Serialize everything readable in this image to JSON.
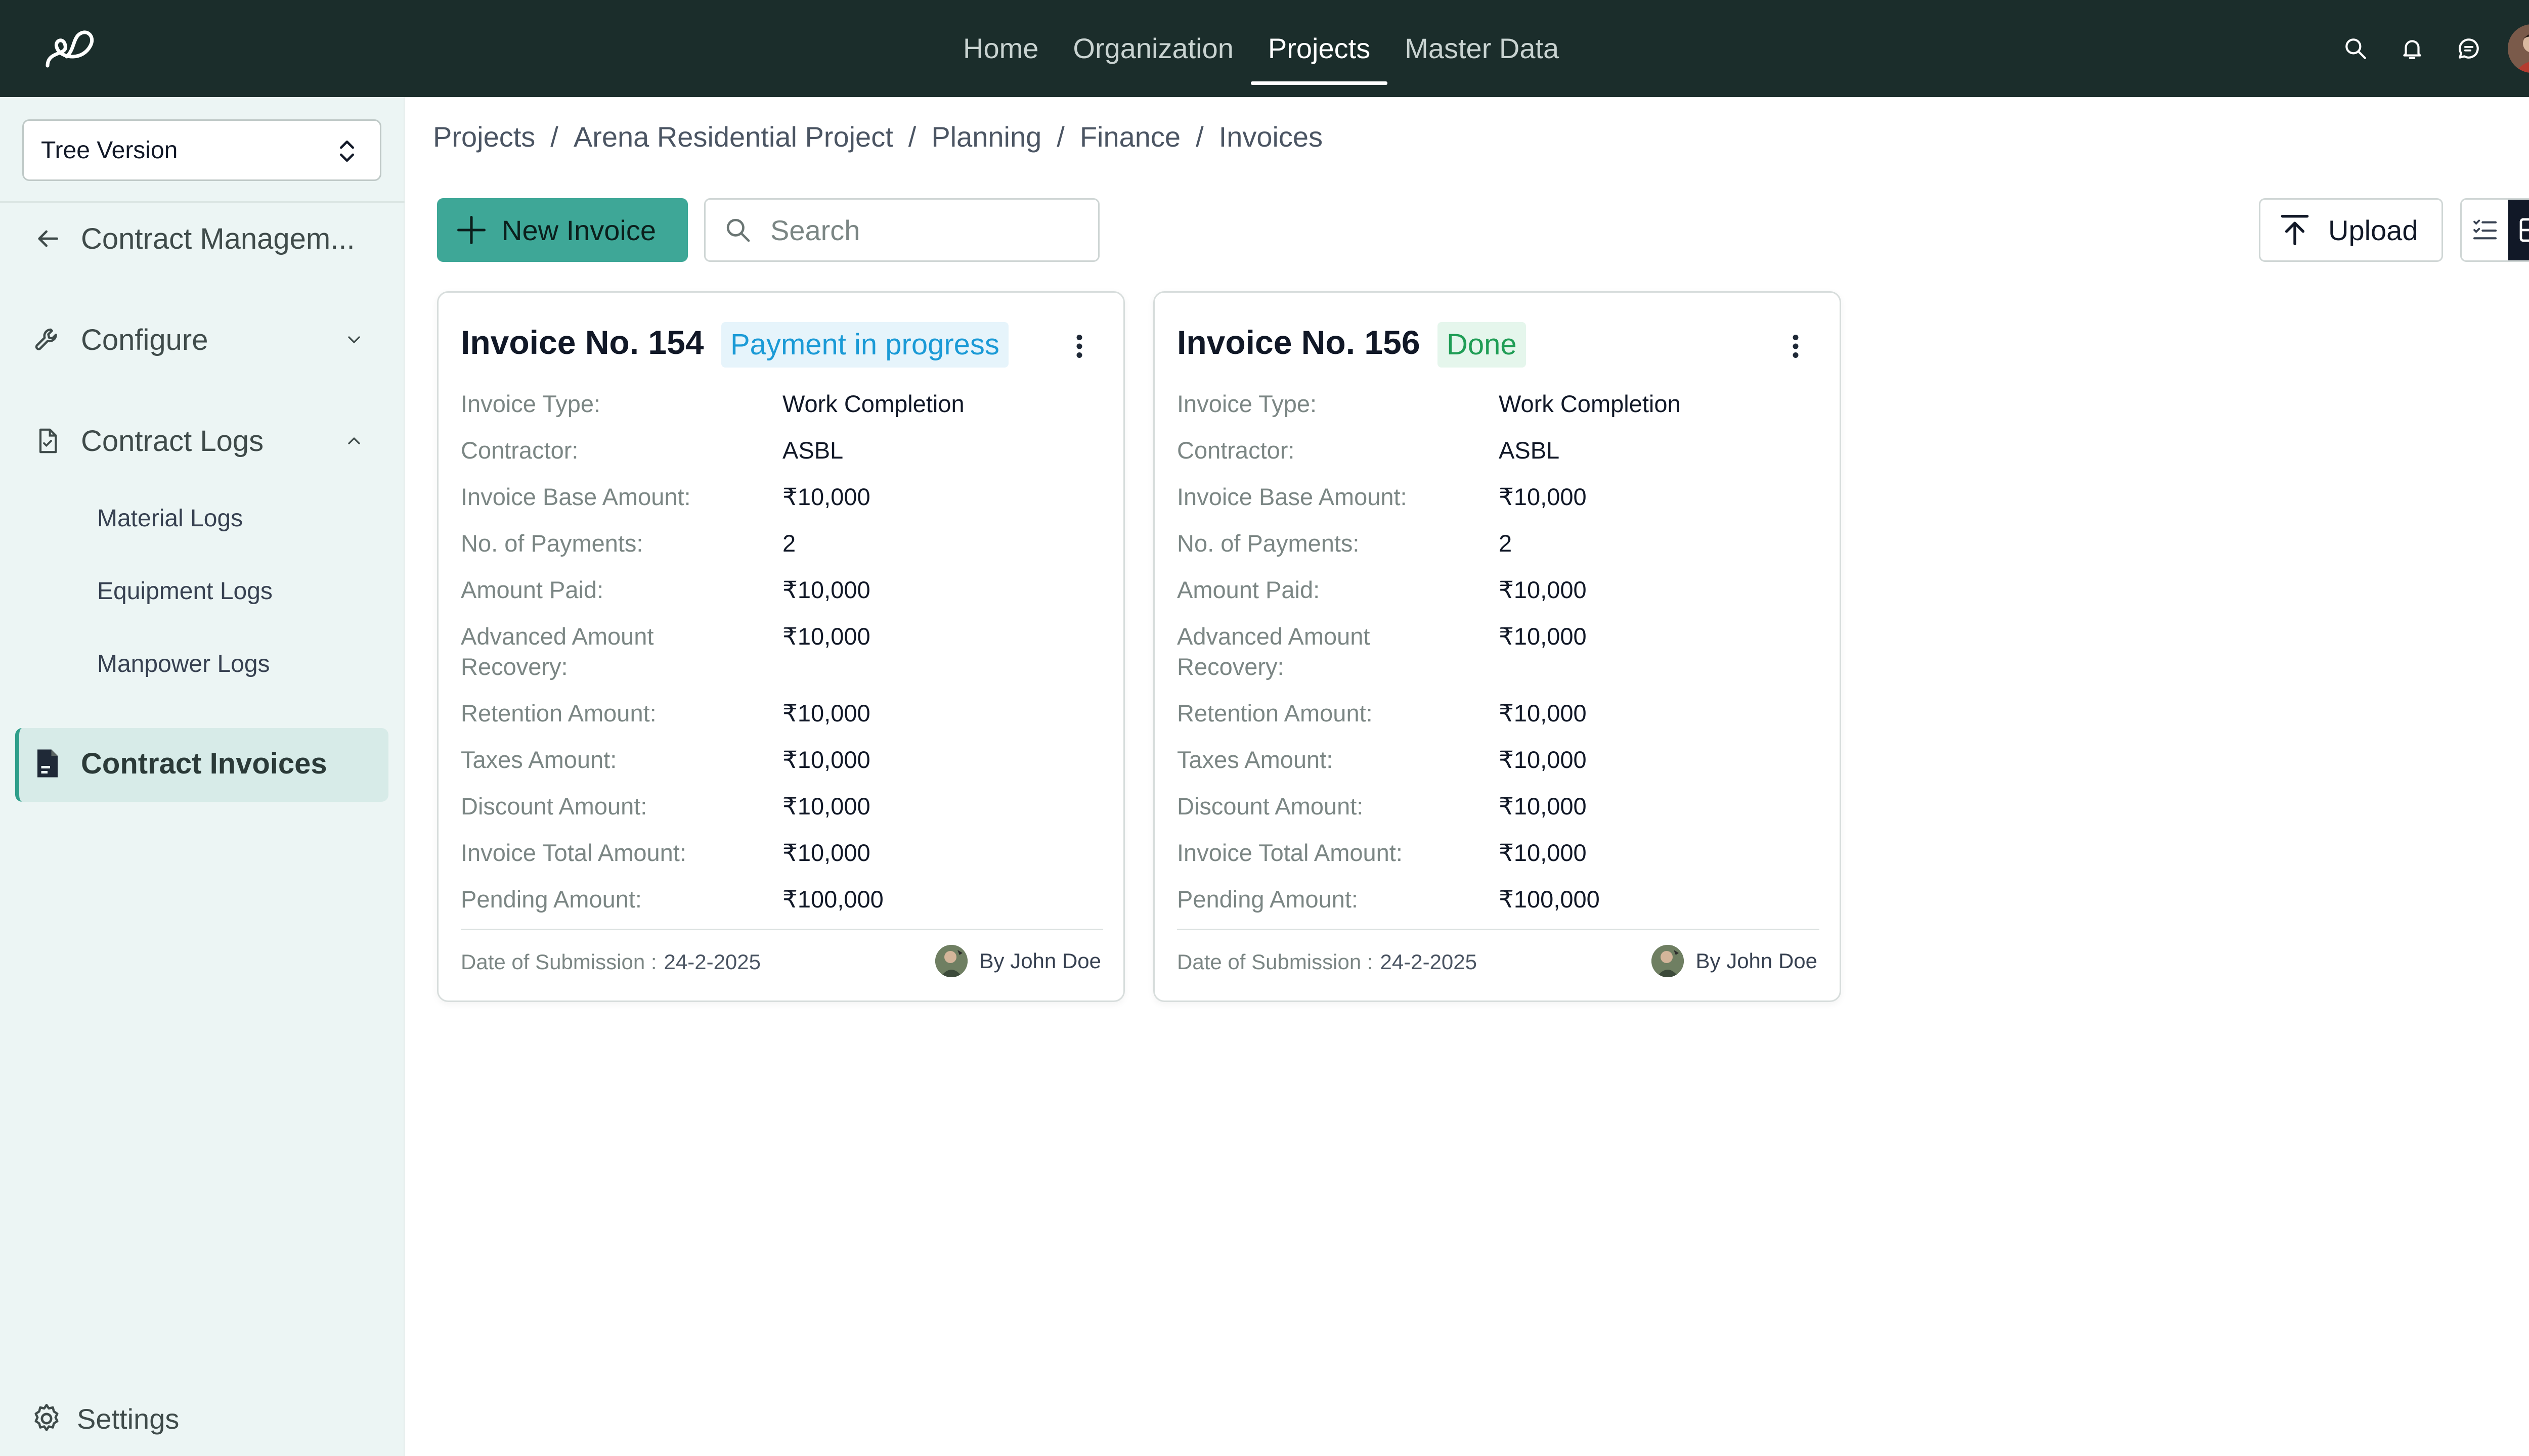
{
  "header": {
    "nav": [
      {
        "label": "Home",
        "active": false
      },
      {
        "label": "Organization",
        "active": false
      },
      {
        "label": "Projects",
        "active": true
      },
      {
        "label": "Master Data",
        "active": false
      }
    ],
    "icons": [
      "search-icon",
      "bell-icon",
      "chat-icon",
      "user-avatar"
    ]
  },
  "sidebar": {
    "tree_select": "Tree Version",
    "back_label": "Contract Managem...",
    "configure_label": "Configure",
    "contract_logs_label": "Contract Logs",
    "sub_items": [
      "Material Logs",
      "Equipment Logs",
      "Manpower Logs"
    ],
    "contract_invoices_label": "Contract Invoices",
    "settings_label": "Settings"
  },
  "breadcrumb": [
    "Projects",
    "Arena Residential Project",
    "Planning",
    "Finance",
    "Invoices"
  ],
  "toolbar": {
    "new_invoice_label": "New Invoice",
    "search_placeholder": "Search",
    "upload_label": "Upload"
  },
  "colors": {
    "topbar": "#1b2d2b",
    "accent": "#3ea797",
    "status_progress_text": "#1a9ad6",
    "status_progress_bg": "#e6f4fb",
    "status_done_text": "#1f9d55",
    "status_done_bg": "#e5f6ec"
  },
  "cards": [
    {
      "title": "Invoice No. 154",
      "status": "Payment in progress",
      "status_kind": "progress",
      "fields": [
        {
          "label": "Invoice Type:",
          "value": "Work Completion"
        },
        {
          "label": "Contractor:",
          "value": "ASBL"
        },
        {
          "label": "Invoice Base Amount:",
          "value": "₹10,000"
        },
        {
          "label": "No. of Payments:",
          "value": "2"
        },
        {
          "label": "Amount Paid:",
          "value": "₹10,000"
        },
        {
          "label": "Advanced Amount Recovery:",
          "value": "₹10,000"
        },
        {
          "label": "Retention Amount:",
          "value": "₹10,000"
        },
        {
          "label": "Taxes Amount:",
          "value": "₹10,000"
        },
        {
          "label": "Discount Amount:",
          "value": "₹10,000"
        },
        {
          "label": "Invoice Total Amount:",
          "value": "₹10,000"
        },
        {
          "label": "Pending Amount:",
          "value": "₹100,000"
        }
      ],
      "submission_label": "Date of Submission :",
      "submission_date": "24-2-2025",
      "author": "By John Doe"
    },
    {
      "title": "Invoice No. 156",
      "status": "Done",
      "status_kind": "done",
      "fields": [
        {
          "label": "Invoice Type:",
          "value": "Work Completion"
        },
        {
          "label": "Contractor:",
          "value": "ASBL"
        },
        {
          "label": "Invoice Base Amount:",
          "value": "₹10,000"
        },
        {
          "label": "No. of Payments:",
          "value": "2"
        },
        {
          "label": "Amount Paid:",
          "value": "₹10,000"
        },
        {
          "label": "Advanced Amount Recovery:",
          "value": "₹10,000"
        },
        {
          "label": "Retention Amount:",
          "value": "₹10,000"
        },
        {
          "label": "Taxes Amount:",
          "value": "₹10,000"
        },
        {
          "label": "Discount Amount:",
          "value": "₹10,000"
        },
        {
          "label": "Invoice Total Amount:",
          "value": "₹10,000"
        },
        {
          "label": "Pending Amount:",
          "value": "₹100,000"
        }
      ],
      "submission_label": "Date of Submission :",
      "submission_date": "24-2-2025",
      "author": "By John Doe"
    }
  ]
}
